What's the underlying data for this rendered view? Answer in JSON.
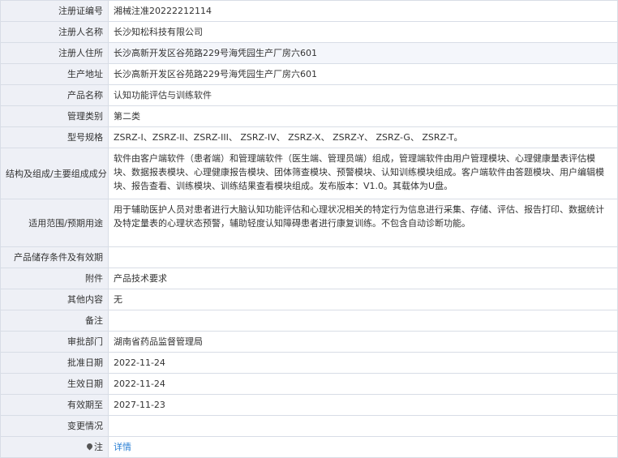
{
  "rows": [
    {
      "label": "注册证编号",
      "value": "湘械注准20222212114"
    },
    {
      "label": "注册人名称",
      "value": "长沙知松科技有限公司"
    },
    {
      "label": "注册人住所",
      "value": "长沙高新开发区谷苑路229号海凭园生产厂房六601"
    },
    {
      "label": "生产地址",
      "value": "长沙高新开发区谷苑路229号海凭园生产厂房六601"
    },
    {
      "label": "产品名称",
      "value": "认知功能评估与训练软件"
    },
    {
      "label": "管理类别",
      "value": "第二类"
    },
    {
      "label": "型号规格",
      "value": "ZSRZ-I、ZSRZ-II、ZSRZ-III、 ZSRZ-IV、 ZSRZ-X、 ZSRZ-Y、 ZSRZ-G、 ZSRZ-T。"
    },
    {
      "label": "结构及组成/主要组成成分",
      "value": "软件由客户端软件（患者端）和管理端软件（医生端、管理员端）组成，管理端软件由用户管理模块、心理健康量表评估模块、数据报表模块、心理健康报告模块、团体筛查模块、预警模块、认知训练模块组成。客户端软件由答题模块、用户编辑模块、报告查看、训练模块、训练结果查看模块组成。发布版本：V1.0。其载体为U盘。"
    },
    {
      "label": "适用范围/预期用途",
      "value": "用于辅助医护人员对患者进行大脑认知功能评估和心理状况相关的特定行为信息进行采集、存储、评估、报告打印、数据统计及特定量表的心理状态预警，辅助轻度认知障碍患者进行康复训练。不包含自动诊断功能。"
    },
    {
      "label": "产品储存条件及有效期",
      "value": ""
    },
    {
      "label": "附件",
      "value": "产品技术要求"
    },
    {
      "label": "其他内容",
      "value": "无"
    },
    {
      "label": "备注",
      "value": ""
    },
    {
      "label": "审批部门",
      "value": "湖南省药品监督管理局"
    },
    {
      "label": "批准日期",
      "value": "2022-11-24"
    },
    {
      "label": "生效日期",
      "value": "2022-11-24"
    },
    {
      "label": "有效期至",
      "value": "2027-11-23"
    },
    {
      "label": "变更情况",
      "value": ""
    }
  ],
  "footer": {
    "label": "注",
    "link": "详情",
    "icon": "pin-icon"
  }
}
